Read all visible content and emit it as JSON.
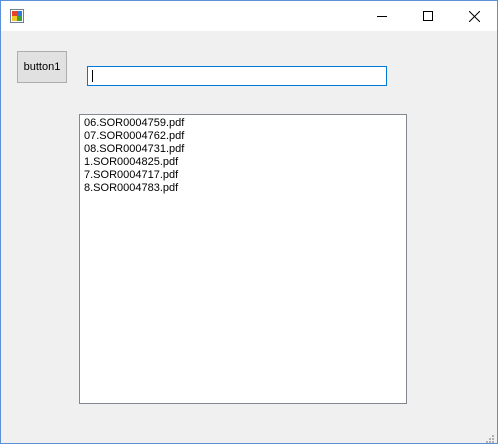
{
  "window": {
    "icon": "winforms-app-icon",
    "minimize_icon": "minimize-icon",
    "maximize_icon": "maximize-icon",
    "close_icon": "close-icon"
  },
  "form": {
    "button_label": "button1",
    "textbox_value": "",
    "list_items": [
      "06.SOR0004759.pdf",
      "07.SOR0004762.pdf",
      "08.SOR0004731.pdf",
      "1.SOR0004825.pdf",
      "7.SOR0004717.pdf",
      "8.SOR0004783.pdf"
    ]
  },
  "colors": {
    "form_background": "#f0f0f0",
    "focus_border": "#0078d7",
    "window_border": "#5b8fd6"
  }
}
